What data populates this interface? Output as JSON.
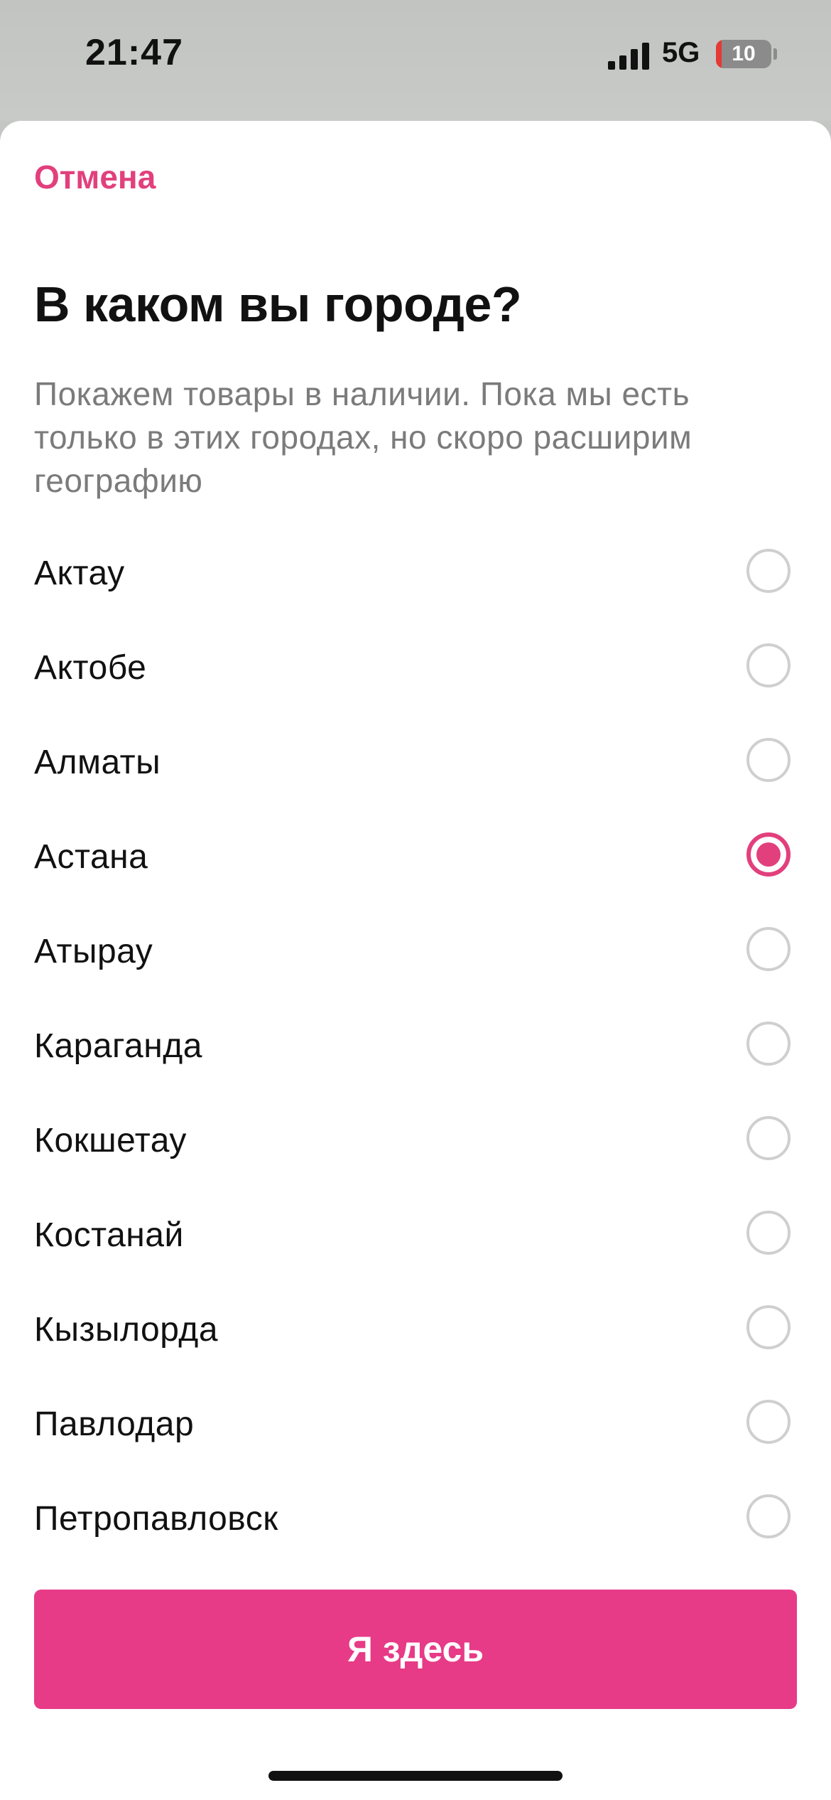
{
  "status_bar": {
    "time": "21:47",
    "network": "5G",
    "battery_text": "10",
    "battery_level_percent": 10,
    "signal_bars": 4
  },
  "sheet": {
    "cancel_label": "Отмена",
    "title": "В каком вы городе?",
    "subtitle": "Покажем товары в наличии. Пока мы есть только в этих городах, но скоро расширим географию",
    "cities": [
      {
        "name": "Актау",
        "selected": false
      },
      {
        "name": "Актобе",
        "selected": false
      },
      {
        "name": "Алматы",
        "selected": false
      },
      {
        "name": "Астана",
        "selected": true
      },
      {
        "name": "Атырау",
        "selected": false
      },
      {
        "name": "Караганда",
        "selected": false
      },
      {
        "name": "Кокшетау",
        "selected": false
      },
      {
        "name": "Костанай",
        "selected": false
      },
      {
        "name": "Кызылорда",
        "selected": false
      },
      {
        "name": "Павлодар",
        "selected": false
      },
      {
        "name": "Петропавловск",
        "selected": false
      }
    ],
    "submit_label": "Я здесь"
  },
  "colors": {
    "accent": "#e2407d",
    "button": "#e73a87",
    "text": "#111111",
    "muted_text": "#7b7b7b",
    "radio_border": "#cfcfcf",
    "battery_low": "#e53935"
  },
  "icons": {
    "signal": "signal-bars-icon",
    "battery": "battery-charging-icon",
    "radio_unselected": "radio-off-icon",
    "radio_selected": "radio-on-icon"
  }
}
